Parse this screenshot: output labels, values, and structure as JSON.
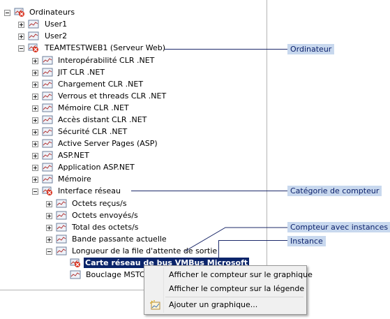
{
  "tree": {
    "root": "Ordinateurs",
    "users": [
      "User1",
      "User2"
    ],
    "computer": "TEAMTESTWEB1 (Serveur Web)",
    "categories": [
      "Interopérabilité CLR .NET",
      "JIT CLR .NET",
      "Chargement CLR .NET",
      "Verrous et threads CLR .NET",
      "Mémoire CLR .NET",
      "Accès distant CLR .NET",
      "Sécurité CLR .NET",
      "Active Server Pages (ASP)",
      "ASP.NET",
      "Application ASP.NET",
      "Mémoire"
    ],
    "network_category": "Interface réseau",
    "counters": [
      "Octets reçus/s",
      "Octets envoyés/s",
      "Total des octets/s",
      "Bande passante actuelle"
    ],
    "queue_counter": "Longueur de la file d'attente de sortie",
    "instances": [
      "Carte réseau de bus VMBus Microsoft",
      "Bouclage MSTCP"
    ]
  },
  "callouts": {
    "computer": "Ordinateur",
    "category": "Catégorie de compteur",
    "counter": "Compteur avec instances",
    "instance": "Instance"
  },
  "menu": {
    "show_on_graph": "Afficher le compteur sur le graphique",
    "show_on_legend": "Afficher le compteur sur la légende",
    "add_graph": "Ajouter un graphique..."
  }
}
